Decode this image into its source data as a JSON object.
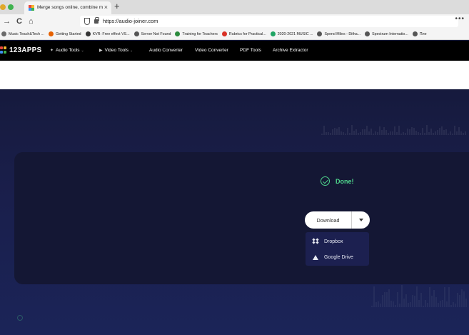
{
  "browser": {
    "tab_title": "Merge songs online, combine m",
    "tab_close": "×",
    "new_tab": "+",
    "url": "https://audio-joiner.com",
    "overflow": "•••",
    "nav": {
      "back": "→",
      "reload": "C",
      "home": "⌂"
    }
  },
  "bookmarks": [
    {
      "label": "Music Teach&Tech ...",
      "icon": "bookmark-icon",
      "color": "#6b6b6b"
    },
    {
      "label": "Getting Started",
      "icon": "firefox-icon",
      "color": "#e66000"
    },
    {
      "label": "KVR: Free effect VS...",
      "icon": "kvr-icon",
      "color": "#333333"
    },
    {
      "label": "Server Not Found",
      "icon": "globe-icon",
      "color": "#555555"
    },
    {
      "label": "Training for Teachers",
      "icon": "training-icon",
      "color": "#2a8a3c"
    },
    {
      "label": "Rubrics for Practical...",
      "icon": "gmail-icon",
      "color": "#d93025"
    },
    {
      "label": "2020-2021 MUSIC ...",
      "icon": "drive-icon",
      "color": "#1fa463"
    },
    {
      "label": "Spend Miles - Ditha...",
      "icon": "globe-icon",
      "color": "#555555"
    },
    {
      "label": "Spectrum Internatio...",
      "icon": "globe-icon",
      "color": "#555555"
    },
    {
      "label": "Пле",
      "icon": "globe-icon",
      "color": "#555555"
    }
  ],
  "site": {
    "logo": "123APPS",
    "menu": [
      {
        "label": "Audio Tools",
        "icon": "✦",
        "caret": "⌄"
      },
      {
        "label": "Video Tools",
        "icon": "▶",
        "caret": "⌄"
      },
      {
        "label": "Audio Converter",
        "icon": "",
        "caret": ""
      },
      {
        "label": "Video Converter",
        "icon": "",
        "caret": ""
      },
      {
        "label": "PDF Tools",
        "icon": "",
        "caret": ""
      },
      {
        "label": "Archive Extractor",
        "icon": "",
        "caret": ""
      }
    ]
  },
  "result": {
    "status": "Done!",
    "download_label": "Download",
    "options": [
      {
        "label": "Dropbox",
        "icon": "dropbox-icon"
      },
      {
        "label": "Google Drive",
        "icon": "google-drive-icon"
      }
    ]
  },
  "colors": {
    "accent_green": "#4fd58c",
    "panel": "#141734",
    "background": "#1a1f4c",
    "nav": "#000000"
  }
}
